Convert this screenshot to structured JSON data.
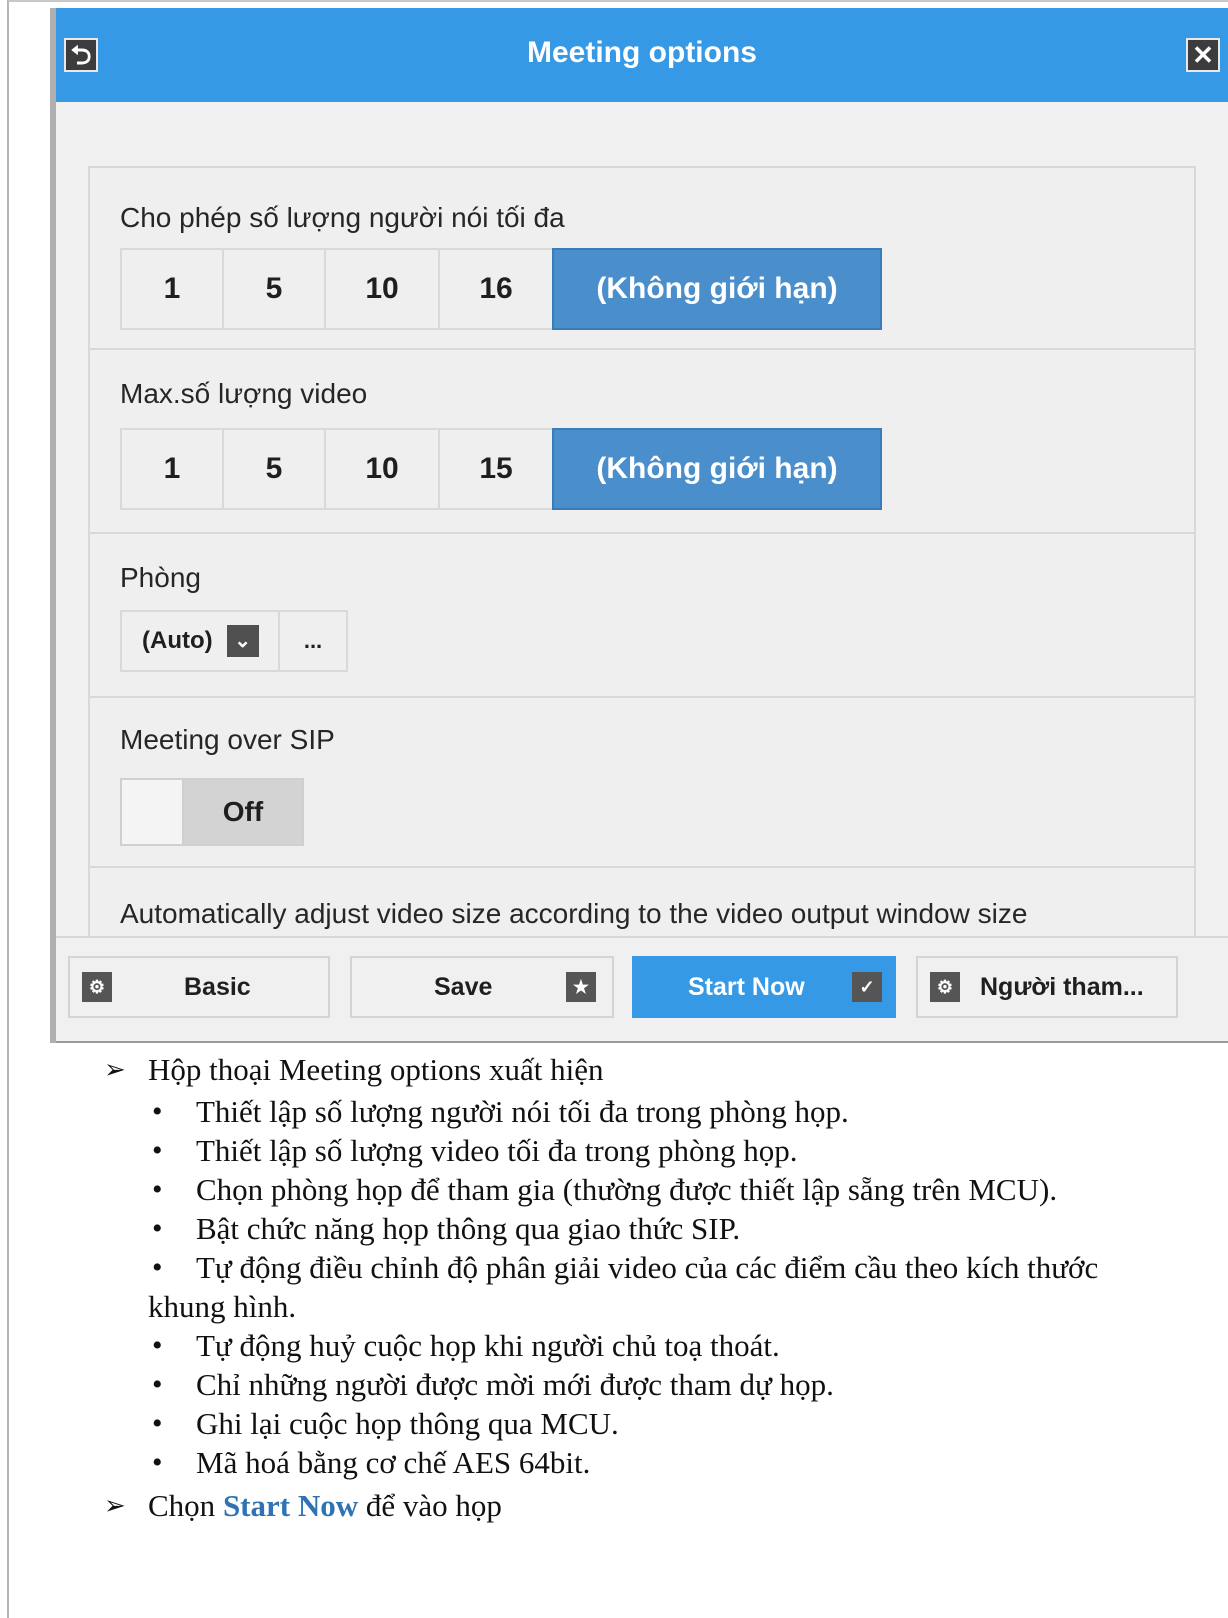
{
  "dialog": {
    "title": "Meeting options",
    "back_icon": "undo-icon",
    "close_icon": "close-icon",
    "max_speakers": {
      "label": "Cho phép số lượng người nói tối đa",
      "options": [
        "1",
        "5",
        "10",
        "16",
        "(Không giới hạn)"
      ],
      "selected": "(Không giới hạn)"
    },
    "max_video": {
      "label": "Max.số lượng video",
      "options": [
        "1",
        "5",
        "10",
        "15",
        "(Không giới hạn)"
      ],
      "selected": "(Không giới hạn)"
    },
    "room": {
      "label": "Phòng",
      "value": "(Auto)",
      "more": "..."
    },
    "sip": {
      "label": "Meeting over SIP",
      "state": "Off"
    },
    "auto_adjust": {
      "label": "Automatically adjust video size according to the video output window size"
    },
    "footer": {
      "basic": "Basic",
      "save": "Save",
      "start_now": "Start Now",
      "participants": "Người tham..."
    }
  },
  "document": {
    "intro": "Hộp thoại Meeting options xuất hiện",
    "bullets": [
      "Thiết lập số lượng người nói tối đa trong phòng họp.",
      "Thiết lập số lượng video tối đa trong phòng họp.",
      "Chọn phòng họp để tham gia (thường được thiết lập sẵng trên MCU).",
      "Bật chức năng họp thông qua giao thức SIP.",
      "Tự động điều chỉnh độ phân giải video của các điểm cầu theo kích thước",
      "khung hình.",
      "Tự động huỷ cuộc họp khi người chủ toạ thoát.",
      "Chỉ những người được mời mới được tham dự họp.",
      "Ghi lại cuộc họp thông qua MCU.",
      "Mã hoá bằng cơ chế AES 64bit."
    ],
    "final_prefix": "Chọn ",
    "final_link": "Start Now",
    "final_suffix": " để vào họp"
  }
}
